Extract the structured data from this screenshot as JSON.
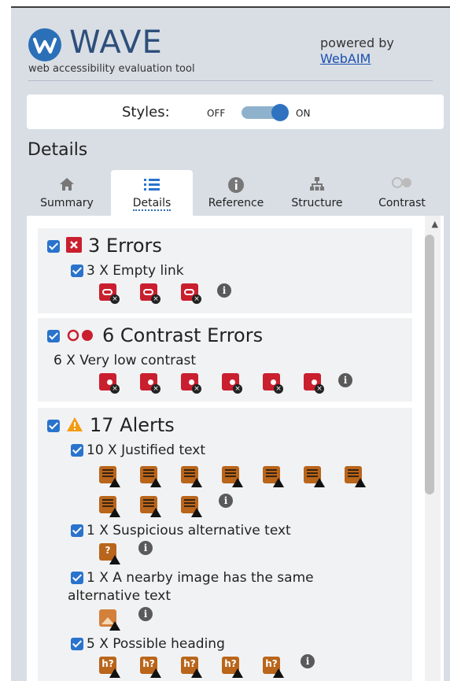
{
  "header": {
    "logo_text": "WAVE",
    "tagline": "web accessibility evaluation tool",
    "powered_by": "powered by",
    "webaim_link": "WebAIM"
  },
  "styles": {
    "label": "Styles:",
    "off": "OFF",
    "on": "ON",
    "state": "on"
  },
  "section_title": "Details",
  "tabs": [
    {
      "label": "Summary",
      "icon": "home-icon"
    },
    {
      "label": "Details",
      "icon": "list-icon",
      "active": true
    },
    {
      "label": "Reference",
      "icon": "info-icon"
    },
    {
      "label": "Structure",
      "icon": "structure-icon"
    },
    {
      "label": "Contrast",
      "icon": "contrast-icon"
    }
  ],
  "categories": {
    "errors": {
      "heading": "3 Errors",
      "items": [
        {
          "label": "3 X Empty link",
          "count": 3
        }
      ]
    },
    "contrast": {
      "heading": "6 Contrast Errors",
      "items": [
        {
          "label": "6 X Very low contrast",
          "count": 6
        }
      ]
    },
    "alerts": {
      "heading": "17 Alerts",
      "items": [
        {
          "label": "10 X Justified text",
          "count": 10
        },
        {
          "label": "1 X Suspicious alternative text",
          "count": 1
        },
        {
          "label_line1": "1 X A nearby image has the same",
          "label_line2": "alternative text",
          "count": 1
        },
        {
          "label": "5 X Possible heading",
          "count": 5
        }
      ]
    }
  },
  "icon_glyphs": {
    "info": "i",
    "suspicious_alt": "?",
    "heading": "h?"
  },
  "colors": {
    "error": "#c91f2e",
    "alert": "#b9651b",
    "accent": "#2a73cc"
  }
}
